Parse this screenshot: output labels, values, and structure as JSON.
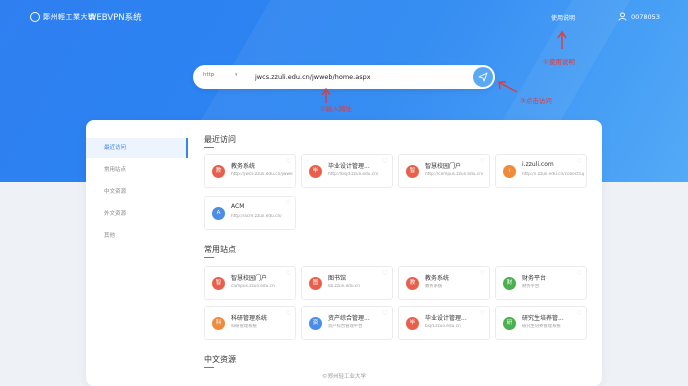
{
  "header": {
    "logo_text": "鄭州輕工業大學",
    "system_title": "WEBVPN系统",
    "link_label": "使用说明",
    "user_id": "0078053"
  },
  "search": {
    "protocol": "http",
    "url_value": "jwcs.zzuli.edu.cn/jwweb/home.aspx",
    "placeholder": ""
  },
  "annotations": {
    "a1": "①使用说明",
    "a2": "②输入网址",
    "a3": "③点击访问"
  },
  "sidebar": {
    "items": [
      {
        "label": "最近访问"
      },
      {
        "label": "常用站点"
      },
      {
        "label": "中文资源"
      },
      {
        "label": "外文资源"
      },
      {
        "label": "其他"
      }
    ]
  },
  "sections": {
    "recent": "最近访问",
    "common": "常用站点",
    "chinese": "中文资源"
  },
  "recent_tiles": [
    {
      "name": "教务系统",
      "url": "http://jwcs.zzuli.edu.cn/jwweb/default.aspx",
      "icon": "教",
      "color": "#e8604c"
    },
    {
      "name": "毕业设计管理...",
      "url": "http://bsjd.zzuli.edu.cn/",
      "icon": "毕",
      "color": "#e8604c"
    },
    {
      "name": "智慧校园门户",
      "url": "http://campus.zzuli.edu.cn/",
      "icon": "智",
      "color": "#e8604c"
    },
    {
      "name": "i.zzuli.com",
      "url": "http://i.zzuli.edu.cn/collect/up_paper_list.html",
      "icon": "i",
      "color": "#f08a3c"
    },
    {
      "name": "ACM",
      "url": "http://acm.zzuli.edu.cn/",
      "icon": "A",
      "color": "#4a8ee8"
    }
  ],
  "common_tiles": [
    {
      "name": "智慧校园门户",
      "url": "campus.zzuli.edu.cn",
      "icon": "智",
      "color": "#e8604c"
    },
    {
      "name": "图书馆",
      "url": "lib.zzuli.edu.cn",
      "icon": "图",
      "color": "#e8604c"
    },
    {
      "name": "教务系统",
      "url": "教务系统",
      "icon": "教",
      "color": "#e8604c"
    },
    {
      "name": "财务平台",
      "url": "财务平台",
      "icon": "财",
      "color": "#4caf50"
    },
    {
      "name": "科研管理系统",
      "url": "科研管理系统",
      "icon": "科",
      "color": "#f08a3c"
    },
    {
      "name": "资产综合管理...",
      "url": "资产综合管理平台",
      "icon": "资",
      "color": "#4a8ee8"
    },
    {
      "name": "毕业设计管理...",
      "url": "bsjd.zzuli.edu.cn",
      "icon": "毕",
      "color": "#e8604c"
    },
    {
      "name": "研究生培养管...",
      "url": "研究生培养管理系统",
      "icon": "研",
      "color": "#4caf50"
    }
  ],
  "footer": "©郑州轻工业大学"
}
